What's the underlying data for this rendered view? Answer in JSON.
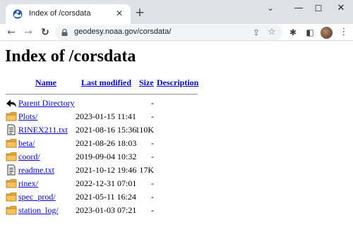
{
  "browser": {
    "tab": {
      "title": "Index of /corsdata",
      "close_glyph": "✕",
      "favicon": "noaa-logo-icon"
    },
    "new_tab_glyph": "+",
    "window_controls": {
      "menu_glyph": "⌄",
      "minimize_glyph": "—",
      "maximize_glyph": "☐",
      "close_glyph": "✕"
    },
    "nav": {
      "back_glyph": "←",
      "forward_glyph": "→",
      "reload_glyph": "↻"
    },
    "address_bar": {
      "url": "geodesy.noaa.gov/corsdata/",
      "lock_icon": "lock-icon"
    },
    "omnibox_icons": {
      "share_glyph": "⇪",
      "star_glyph": "☆"
    },
    "toolbar_icons": {
      "extensions_glyph": "✱",
      "side_panel_glyph": "◧",
      "menu_glyph": "⋮"
    }
  },
  "page": {
    "title": "Index of /corsdata",
    "columns": {
      "name": "Name",
      "last_modified": "Last modified",
      "size": "Size",
      "description": "Description"
    },
    "entries": [
      {
        "name": "Parent Directory",
        "modified": "",
        "size": "-",
        "icon": "back-arrow-icon"
      },
      {
        "name": "Plots/",
        "modified": "2023-01-15 11:41",
        "size": "-",
        "icon": "folder-icon"
      },
      {
        "name": "RINEX211.txt",
        "modified": "2021-08-16 15:36",
        "size": "110K",
        "icon": "text-file-icon"
      },
      {
        "name": "beta/",
        "modified": "2021-08-26 18:03",
        "size": "-",
        "icon": "folder-icon"
      },
      {
        "name": "coord/",
        "modified": "2019-09-04 10:32",
        "size": "-",
        "icon": "folder-icon"
      },
      {
        "name": "readme.txt",
        "modified": "2021-10-12 19:46",
        "size": "17K",
        "icon": "text-file-icon"
      },
      {
        "name": "rinex/",
        "modified": "2022-12-31 07:01",
        "size": "-",
        "icon": "folder-icon"
      },
      {
        "name": "spec_prod/",
        "modified": "2021-05-11 16:24",
        "size": "-",
        "icon": "folder-icon"
      },
      {
        "name": "station_log/",
        "modified": "2023-01-03 07:21",
        "size": "-",
        "icon": "folder-icon"
      }
    ]
  },
  "colors": {
    "link": "#0000ee",
    "chrome_bg": "#dee1e6",
    "omnibox_bg": "#f1f3f4",
    "folder": "#e8a83a"
  }
}
